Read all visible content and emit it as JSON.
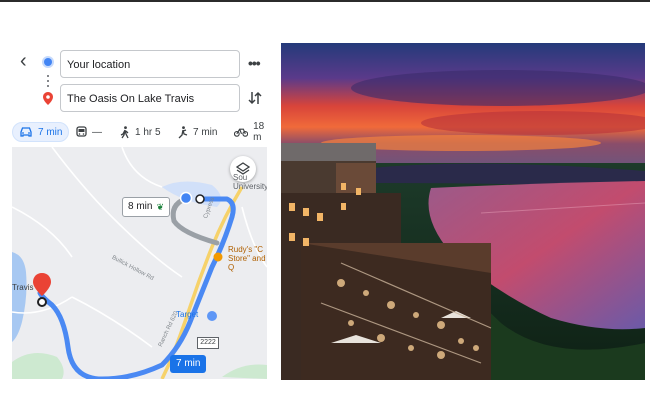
{
  "directions": {
    "origin_value": "Your location",
    "destination_value": "The Oasis On Lake Travis",
    "back_icon": "arrow-back-icon",
    "more_icon": "more-horizontal-icon",
    "swap_icon": "swap-vertical-icon"
  },
  "modes": [
    {
      "name": "car",
      "label": "7 min",
      "active": true
    },
    {
      "name": "transit",
      "label": "—",
      "active": false
    },
    {
      "name": "walk",
      "label": "1 hr 5",
      "active": false
    },
    {
      "name": "rideshare",
      "label": "7 min",
      "active": false
    },
    {
      "name": "bike",
      "label": "18 m",
      "active": false
    }
  ],
  "map": {
    "route_time_alt": "8 min",
    "route_time_main": "7 min",
    "labels": {
      "university": "Sou\nUniversity Te",
      "store": "Rudy's \"C\nStore\" and\nQ",
      "target": "Target",
      "travis": "Travis",
      "road1": "Bullick Hollow Rd",
      "road2": "Cypress",
      "road3": "Ranch Rd 620",
      "highway_shield": "2222"
    },
    "colors": {
      "route": "#4a89f3",
      "route_alt": "#9aa0a6",
      "water": "#a7c8f2",
      "park": "#cde9d0",
      "destination_pin": "#ea4335"
    }
  }
}
